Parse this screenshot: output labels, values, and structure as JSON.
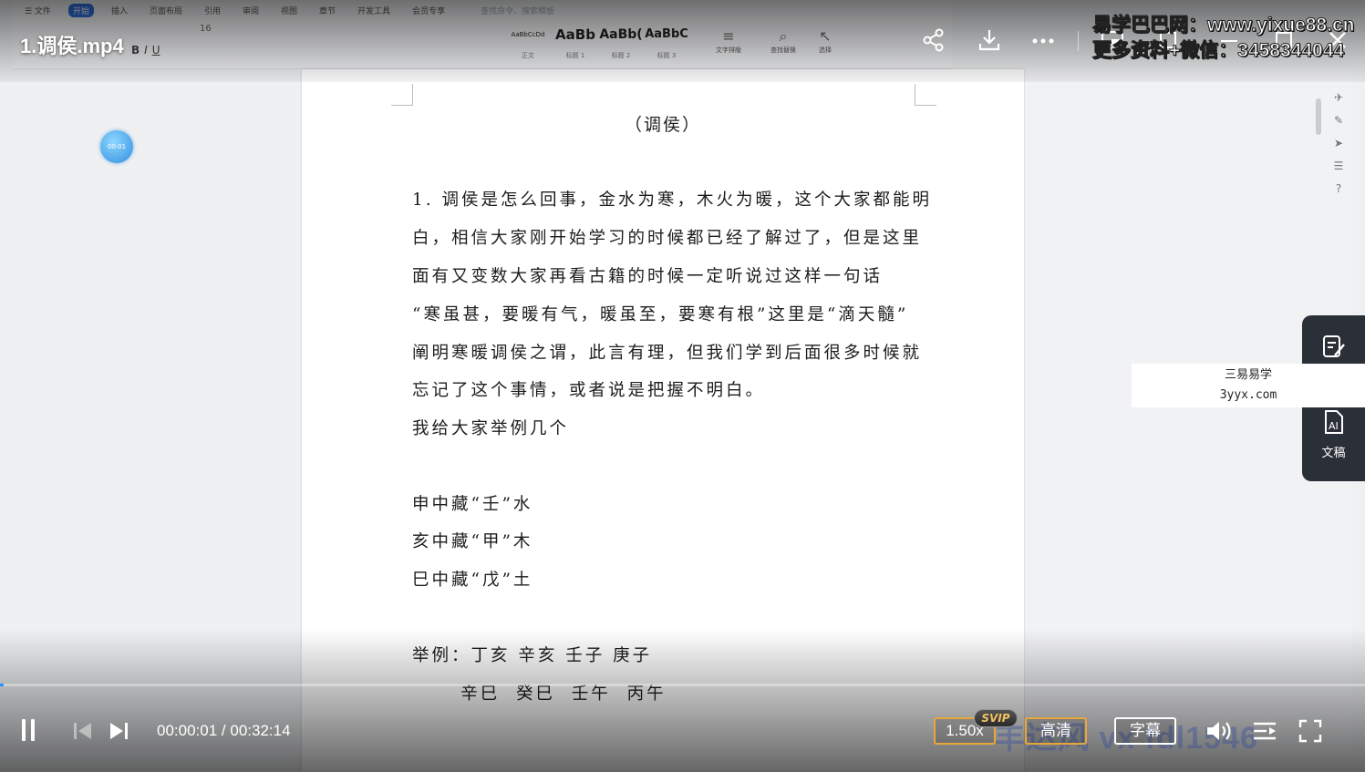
{
  "ribbon": {
    "menu": [
      "☰ 文件",
      "插入",
      "页面布局",
      "引用",
      "审阅",
      "视图",
      "章节",
      "开发工具",
      "会员专享"
    ],
    "active_tab": "开始",
    "search_hint": "查找命令、搜索模板",
    "font_size": "16",
    "styles": [
      {
        "preview": "AaBbCcDd",
        "name": "正文"
      },
      {
        "preview": "AaBb",
        "name": "标题 1"
      },
      {
        "preview": "AaBb(",
        "name": "标题 2"
      },
      {
        "preview": "AaBbC",
        "name": "标题 3"
      }
    ],
    "tools": [
      "文字排版",
      "查找替换",
      "选择"
    ]
  },
  "document": {
    "title": "（调侯）",
    "lines": [
      "1. 调侯是怎么回事，金水为寒，木火为暖，这个大家都能明",
      "白，相信大家刚开始学习的时候都已经了解过了，但是这里",
      "面有又变数大家再看古籍的时候一定听说过这样一句话",
      "“寒虽甚，要暖有气，暖虽至，要寒有根”这里是“滴天髓”",
      "阐明寒暖调侯之谓，此言有理，但我们学到后面很多时候就",
      "忘记了这个事情，或者说是把握不明白。",
      "我给大家举例几个",
      "",
      "申中藏“壬”水",
      "亥中藏“甲”木",
      "巳中藏“戊”土",
      "",
      "举例：丁亥  辛亥  壬子  庚子",
      "      辛巳  癸巳  壬午  丙午"
    ]
  },
  "video": {
    "title": "1.调侯.mp4",
    "current_time": "00:00:01",
    "total_time": "00:32:14",
    "progress_fraction": 0.0005,
    "speed": "1.50x",
    "svip": "SVIP",
    "quality": "高清",
    "subtitle": "字幕",
    "timer_badge": "00:01",
    "accent": "#2f8fff"
  },
  "watermark": {
    "top_line1": "易学巴巴网：www.yixue88.cn",
    "top_line2": "更多资料+微信：3458344044",
    "box_line1": "三易易学",
    "box_line2": "3yyx.com",
    "bottom": "丰达风 vx  fdl1546"
  },
  "float_panel": {
    "label": "文稿"
  }
}
